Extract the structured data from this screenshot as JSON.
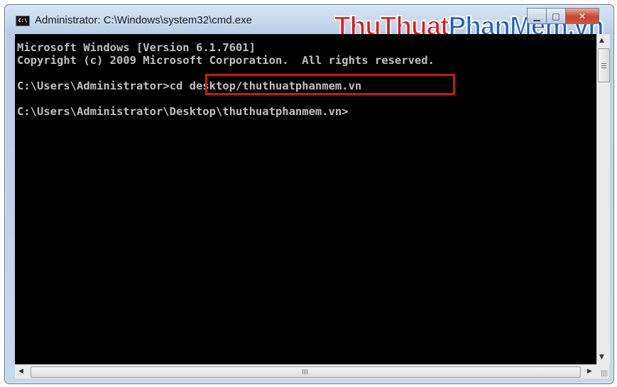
{
  "window": {
    "title": "Administrator: C:\\Windows\\system32\\cmd.exe",
    "icon_label": "C:\\",
    "controls": {
      "minimize_icon": "minimize-icon",
      "maximize_icon": "maximize-icon",
      "close_icon": "close-icon"
    }
  },
  "watermark": {
    "part1": "ThuThuat",
    "part2": "PhanMem",
    "part3": ".vn",
    "colors": {
      "primary": "#e2161b",
      "secondary": "#1f5fc7"
    }
  },
  "console": {
    "lines": [
      "Microsoft Windows [Version 6.1.7601]",
      "Copyright (c) 2009 Microsoft Corporation.  All rights reserved.",
      "",
      "C:\\Users\\Administrator>cd desktop/thuthuatphanmem.vn",
      "",
      "C:\\Users\\Administrator\\Desktop\\thuthuatphanmem.vn>"
    ],
    "text_color": "#c0c0c0",
    "background": "#000000",
    "highlight_color": "#c8181d"
  },
  "scrollbars": {
    "vertical_up_icon": "up-arrow-icon",
    "vertical_down_icon": "down-arrow-icon",
    "horizontal_left_icon": "left-arrow-icon",
    "horizontal_right_icon": "right-arrow-icon"
  }
}
